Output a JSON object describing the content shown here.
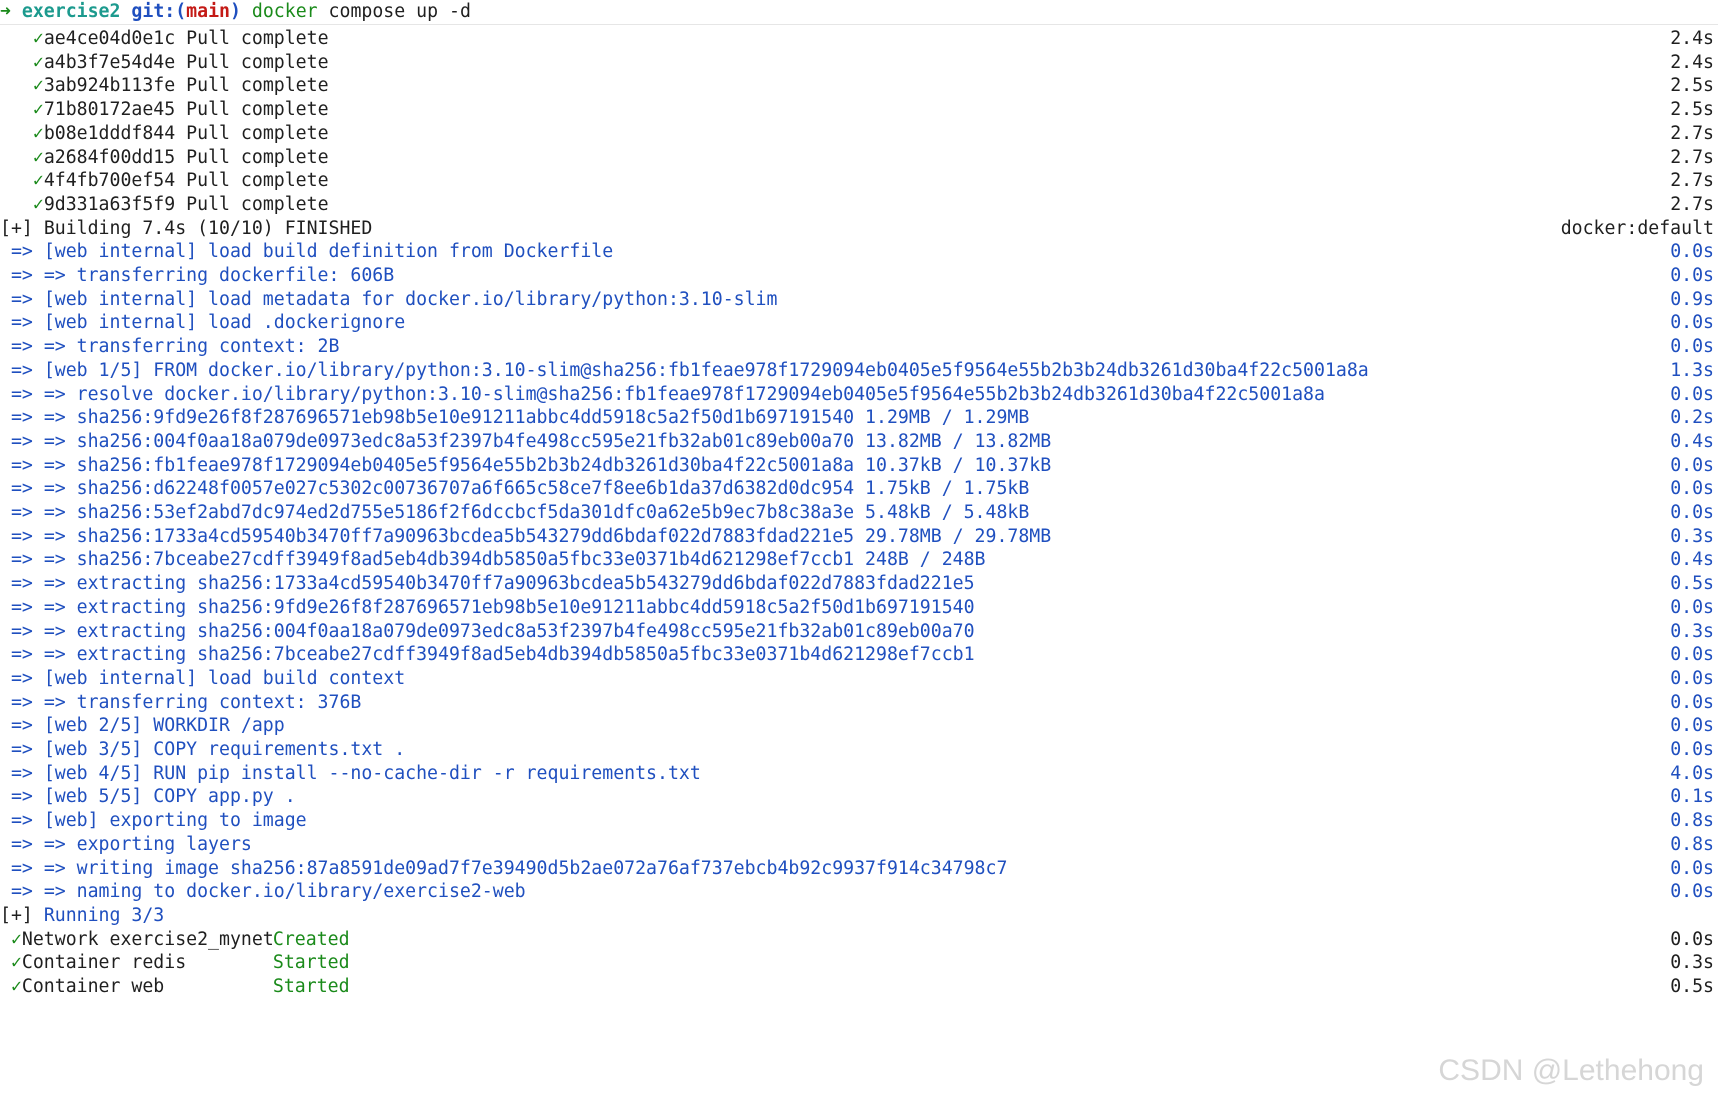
{
  "prompt": {
    "arrow": "➜",
    "dir": "exercise2",
    "git_label": "git:(",
    "branch": "main",
    "git_close": ")",
    "command": "docker",
    "args": "compose up -d"
  },
  "pulls": [
    {
      "id": "ae4ce04d0e1c",
      "status": "Pull complete",
      "time": "2.4s"
    },
    {
      "id": "a4b3f7e54d4e",
      "status": "Pull complete",
      "time": "2.4s"
    },
    {
      "id": "3ab924b113fe",
      "status": "Pull complete",
      "time": "2.5s"
    },
    {
      "id": "71b80172ae45",
      "status": "Pull complete",
      "time": "2.5s"
    },
    {
      "id": "b08e1dddf844",
      "status": "Pull complete",
      "time": "2.7s"
    },
    {
      "id": "a2684f00dd15",
      "status": "Pull complete",
      "time": "2.7s"
    },
    {
      "id": "4f4fb700ef54",
      "status": "Pull complete",
      "time": "2.7s"
    },
    {
      "id": "9d331a63f5f9",
      "status": "Pull complete",
      "time": "2.7s"
    }
  ],
  "building": {
    "prefix": "[+]",
    "text": "Building 7.4s (10/10) FINISHED",
    "context": "docker:default"
  },
  "build_steps": [
    {
      "text": "[web internal] load build definition from Dockerfile",
      "time": "0.0s"
    },
    {
      "text": "=> transferring dockerfile: 606B",
      "time": "0.0s"
    },
    {
      "text": "[web internal] load metadata for docker.io/library/python:3.10-slim",
      "time": "0.9s"
    },
    {
      "text": "[web internal] load .dockerignore",
      "time": "0.0s"
    },
    {
      "text": "=> transferring context: 2B",
      "time": "0.0s"
    },
    {
      "text": "[web 1/5] FROM docker.io/library/python:3.10-slim@sha256:fb1feae978f1729094eb0405e5f9564e55b2b3b24db3261d30ba4f22c5001a8a",
      "time": "1.3s"
    },
    {
      "text": "=> resolve docker.io/library/python:3.10-slim@sha256:fb1feae978f1729094eb0405e5f9564e55b2b3b24db3261d30ba4f22c5001a8a",
      "time": "0.0s"
    },
    {
      "text": "=> sha256:9fd9e26f8f287696571eb98b5e10e91211abbc4dd5918c5a2f50d1b697191540 1.29MB / 1.29MB",
      "time": "0.2s"
    },
    {
      "text": "=> sha256:004f0aa18a079de0973edc8a53f2397b4fe498cc595e21fb32ab01c89eb00a70 13.82MB / 13.82MB",
      "time": "0.4s"
    },
    {
      "text": "=> sha256:fb1feae978f1729094eb0405e5f9564e55b2b3b24db3261d30ba4f22c5001a8a 10.37kB / 10.37kB",
      "time": "0.0s"
    },
    {
      "text": "=> sha256:d62248f0057e027c5302c00736707a6f665c58ce7f8ee6b1da37d6382d0dc954 1.75kB / 1.75kB",
      "time": "0.0s"
    },
    {
      "text": "=> sha256:53ef2abd7dc974ed2d755e5186f2f6dccbcf5da301dfc0a62e5b9ec7b8c38a3e 5.48kB / 5.48kB",
      "time": "0.0s"
    },
    {
      "text": "=> sha256:1733a4cd59540b3470ff7a90963bcdea5b543279dd6bdaf022d7883fdad221e5 29.78MB / 29.78MB",
      "time": "0.3s"
    },
    {
      "text": "=> sha256:7bceabe27cdff3949f8ad5eb4db394db5850a5fbc33e0371b4d621298ef7ccb1 248B / 248B",
      "time": "0.4s"
    },
    {
      "text": "=> extracting sha256:1733a4cd59540b3470ff7a90963bcdea5b543279dd6bdaf022d7883fdad221e5",
      "time": "0.5s"
    },
    {
      "text": "=> extracting sha256:9fd9e26f8f287696571eb98b5e10e91211abbc4dd5918c5a2f50d1b697191540",
      "time": "0.0s"
    },
    {
      "text": "=> extracting sha256:004f0aa18a079de0973edc8a53f2397b4fe498cc595e21fb32ab01c89eb00a70",
      "time": "0.3s"
    },
    {
      "text": "=> extracting sha256:7bceabe27cdff3949f8ad5eb4db394db5850a5fbc33e0371b4d621298ef7ccb1",
      "time": "0.0s"
    },
    {
      "text": "[web internal] load build context",
      "time": "0.0s"
    },
    {
      "text": "=> transferring context: 376B",
      "time": "0.0s"
    },
    {
      "text": "[web 2/5] WORKDIR /app",
      "time": "0.0s"
    },
    {
      "text": "[web 3/5] COPY requirements.txt .",
      "time": "0.0s"
    },
    {
      "text": "[web 4/5] RUN pip install --no-cache-dir -r requirements.txt",
      "time": "4.0s"
    },
    {
      "text": "[web 5/5] COPY app.py .",
      "time": "0.1s"
    },
    {
      "text": "[web] exporting to image",
      "time": "0.8s"
    },
    {
      "text": "=> exporting layers",
      "time": "0.8s"
    },
    {
      "text": "=> writing image sha256:87a8591de09ad7f7e39490d5b2ae072a76af737ebcb4b92c9937f914c34798c7",
      "time": "0.0s"
    },
    {
      "text": "=> naming to docker.io/library/exercise2-web",
      "time": "0.0s"
    }
  ],
  "step_prefix": "=>",
  "running": {
    "prefix": "[+]",
    "text": "Running 3/3"
  },
  "resources": [
    {
      "name": "Network exercise2_mynet",
      "state": "Created",
      "time": "0.0s"
    },
    {
      "name": "Container redis",
      "state": "Started",
      "time": "0.3s"
    },
    {
      "name": "Container web",
      "state": "Started",
      "time": "0.5s"
    }
  ],
  "check_glyph": "✓",
  "watermark": "CSDN @Lethehong",
  "colors": {
    "green": "#1a8a1a",
    "blue": "#1f4fbf",
    "red": "#c41a16",
    "teal": "#1c9a8e"
  }
}
